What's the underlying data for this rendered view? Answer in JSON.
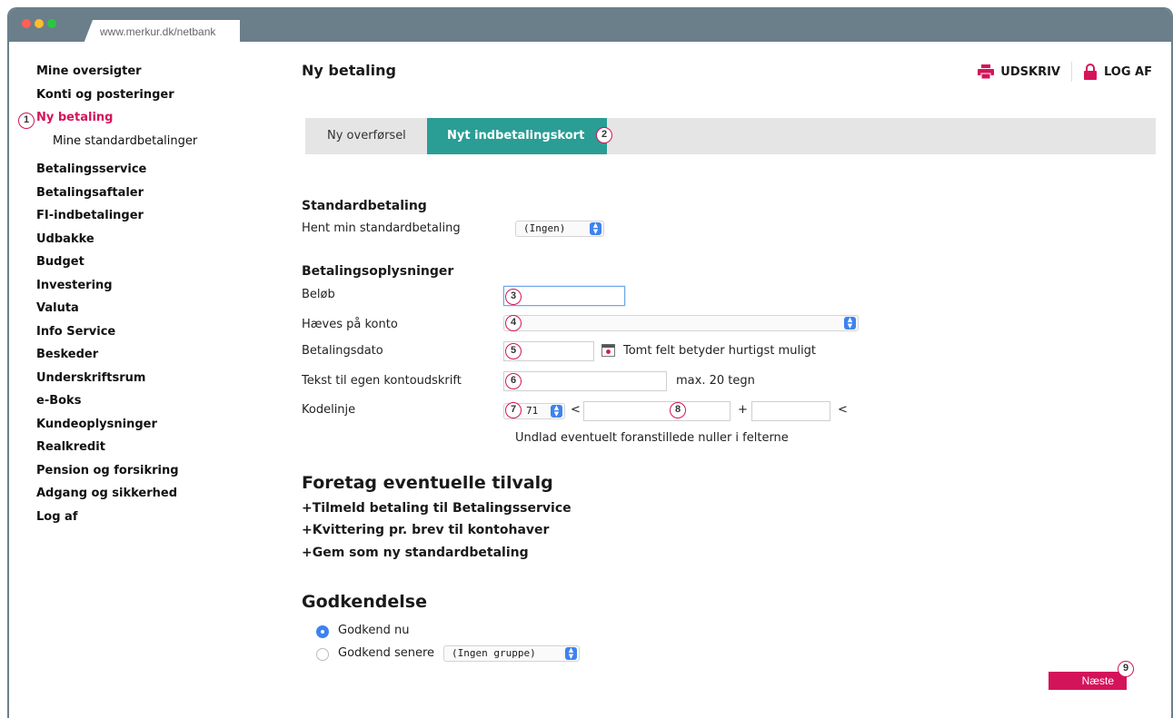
{
  "browser": {
    "url": "www.merkur.dk/netbank"
  },
  "sidebar": {
    "items": [
      {
        "label": "Mine oversigter"
      },
      {
        "label": "Konti og posteringer"
      },
      {
        "label": "Ny betaling"
      },
      {
        "label": "Mine standardbetalinger"
      },
      {
        "label": "Betalingsservice"
      },
      {
        "label": "Betalingsaftaler"
      },
      {
        "label": "FI-indbetalinger"
      },
      {
        "label": "Udbakke"
      },
      {
        "label": "Budget"
      },
      {
        "label": "Investering"
      },
      {
        "label": "Valuta"
      },
      {
        "label": "Info Service"
      },
      {
        "label": "Beskeder"
      },
      {
        "label": "Underskriftsrum"
      },
      {
        "label": "e-Boks"
      },
      {
        "label": "Kundeoplysninger"
      },
      {
        "label": "Realkredit"
      },
      {
        "label": "Pension og forsikring"
      },
      {
        "label": "Adgang og sikkerhed"
      },
      {
        "label": "Log af"
      }
    ]
  },
  "header": {
    "title": "Ny betaling",
    "print_label": "UDSKRIV",
    "logout_label": "LOG AF"
  },
  "tabs": [
    {
      "label": "Ny overførsel"
    },
    {
      "label": "Nyt indbetalingskort"
    }
  ],
  "standard": {
    "heading": "Standardbetaling",
    "fetch_label": "Hent min standardbetaling",
    "fetch_value": "(Ingen)"
  },
  "payment": {
    "heading": "Betalingsoplysninger",
    "amount_label": "Beløb",
    "account_label": "Hæves på konto",
    "date_label": "Betalingsdato",
    "date_hint": "Tomt felt betyder hurtigst muligt",
    "text_label": "Tekst til egen kontoudskrift",
    "text_hint": "max. 20 tegn",
    "code_label": "Kodelinje",
    "code_type": "71",
    "lt1": "<",
    "plus": "+",
    "lt2": "<",
    "code_hint": "Undlad eventuelt foranstillede nuller i felterne"
  },
  "options": {
    "heading": "Foretag eventuelle tilvalg",
    "items": [
      {
        "label": "Tilmeld betaling til Betalingsservice"
      },
      {
        "label": "Kvittering pr. brev til kontohaver"
      },
      {
        "label": "Gem som ny standardbetaling"
      }
    ]
  },
  "approval": {
    "heading": "Godkendelse",
    "now_label": "Godkend nu",
    "later_label": "Godkend senere",
    "group_value": "(Ingen gruppe)"
  },
  "next_label": "Næste",
  "badges": [
    "1",
    "2",
    "3",
    "4",
    "5",
    "6",
    "7",
    "8",
    "9"
  ],
  "colors": {
    "accent": "#d4145a",
    "tab_active": "#2a9d95",
    "chrome": "#6b7f8a",
    "select_arrow": "#3d82f0"
  }
}
